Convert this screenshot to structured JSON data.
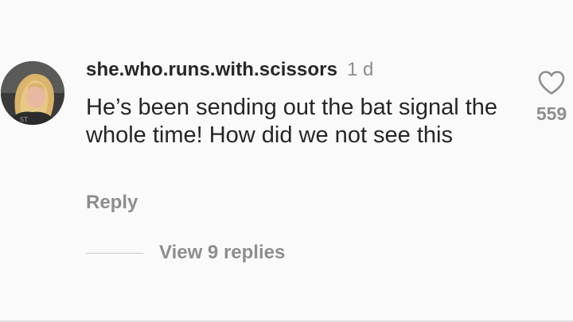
{
  "comment": {
    "username": "she.who.runs.with.scissors",
    "time": "1 d",
    "text": "He’s been sending out the bat signal the whole time! How did we not see this",
    "reply_label": "Reply",
    "like_count": "559",
    "view_replies_label": "View 9 replies"
  },
  "icons": {
    "like": "heart-outline-icon",
    "avatar": "user-profile-photo"
  },
  "colors": {
    "background": "#fafafa",
    "primary_text": "#262626",
    "secondary_text": "#8e8e8e",
    "divider": "#c7c7c7"
  }
}
